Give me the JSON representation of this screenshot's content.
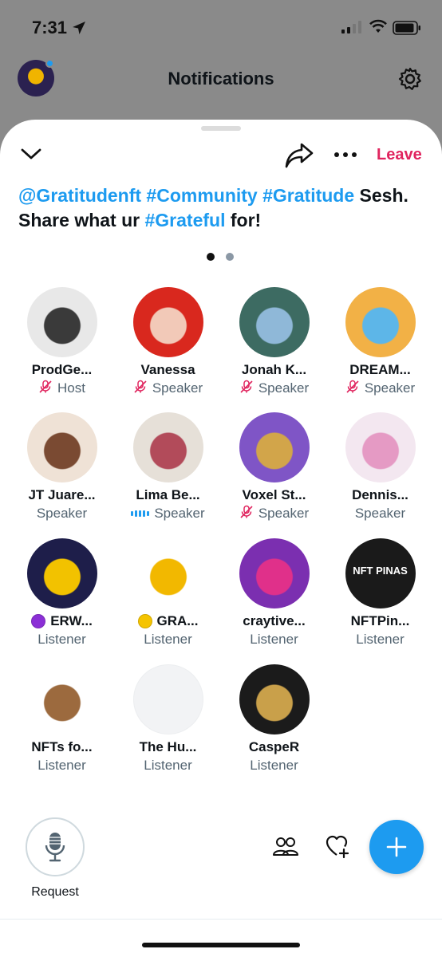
{
  "status": {
    "time": "7:31"
  },
  "header": {
    "title": "Notifications"
  },
  "space": {
    "leave_label": "Leave",
    "title_parts": [
      {
        "text": "@Gratitudenft",
        "tag": true
      },
      {
        "text": " ",
        "tag": false
      },
      {
        "text": "#Community",
        "tag": true
      },
      {
        "text": " ",
        "tag": false
      },
      {
        "text": "#Gratitude",
        "tag": true
      },
      {
        "text": " Sesh. Share what ur ",
        "tag": false
      },
      {
        "text": "#Grateful",
        "tag": true
      },
      {
        "text": " for!",
        "tag": false
      }
    ],
    "pages": 2,
    "current_page": 1
  },
  "participants": [
    {
      "name": "ProdGe...",
      "role": "Host",
      "status": "muted",
      "avatar": "ProdGe-avatar",
      "avatar_colors": [
        "#e8e8e8",
        "#3a3a3a"
      ]
    },
    {
      "name": "Vanessa",
      "role": "Speaker",
      "status": "muted",
      "avatar": "Vanessa-avatar",
      "avatar_colors": [
        "#d9281e",
        "#f2c9b8"
      ]
    },
    {
      "name": "Jonah K...",
      "role": "Speaker",
      "status": "muted",
      "avatar": "Jonah-avatar",
      "avatar_colors": [
        "#3d6b62",
        "#8fb8d8"
      ]
    },
    {
      "name": "DREAM...",
      "role": "Speaker",
      "status": "muted",
      "avatar": "DREAM-avatar",
      "avatar_colors": [
        "#f2b146",
        "#5db6e8"
      ]
    },
    {
      "name": "JT Juare...",
      "role": "Speaker",
      "status": "none",
      "avatar": "JT-avatar",
      "avatar_colors": [
        "#efe2d6",
        "#7a4a32"
      ]
    },
    {
      "name": "Lima Be...",
      "role": "Speaker",
      "status": "speaking",
      "avatar": "Lima-avatar",
      "avatar_colors": [
        "#e6e0d8",
        "#b24b5a"
      ]
    },
    {
      "name": "Voxel St...",
      "role": "Speaker",
      "status": "muted",
      "avatar": "Voxel-avatar",
      "avatar_colors": [
        "#7f55c6",
        "#d2a54a"
      ]
    },
    {
      "name": "Dennis...",
      "role": "Speaker",
      "status": "none",
      "avatar": "Dennis-avatar",
      "avatar_colors": [
        "#f3e7f0",
        "#e59ac4"
      ]
    },
    {
      "name": "ERW...",
      "role": "Listener",
      "status": "none",
      "badge_color": "#8b2fd6",
      "avatar": "ERW-avatar",
      "avatar_colors": [
        "#1e1e4a",
        "#f2c200"
      ]
    },
    {
      "name": "GRA...",
      "role": "Listener",
      "status": "none",
      "badge_color": "#f5c400",
      "avatar": "GRA-avatar",
      "avatar_colors": [
        "#ffffff",
        "#f2b800"
      ]
    },
    {
      "name": "craytive...",
      "role": "Listener",
      "status": "none",
      "avatar": "craytive-avatar",
      "avatar_colors": [
        "#7b2fb0",
        "#e0308a"
      ]
    },
    {
      "name": "NFTPin...",
      "role": "Listener",
      "status": "none",
      "avatar": "NFTPin-avatar",
      "avatar_text": "NFT PINAS",
      "avatar_colors": [
        "#1a1a1a",
        "#c0392b"
      ]
    },
    {
      "name": "NFTs fo...",
      "role": "Listener",
      "status": "none",
      "avatar": "NFTsfo-avatar",
      "avatar_colors": [
        "#ffffff",
        "#9c6a3e"
      ]
    },
    {
      "name": "The Hu...",
      "role": "Listener",
      "status": "none",
      "avatar": "TheHu-avatar",
      "avatar_colors": [
        "#f2f3f5",
        "#f2f3f5"
      ]
    },
    {
      "name": "CaspeR",
      "role": "Listener",
      "status": "none",
      "avatar": "CaspeR-avatar",
      "avatar_colors": [
        "#1b1b1b",
        "#c9a04a"
      ]
    }
  ],
  "footer": {
    "request_label": "Request"
  },
  "colors": {
    "accent": "#1d9bf0",
    "leave": "#e0245e",
    "muted": "#e0245e"
  }
}
